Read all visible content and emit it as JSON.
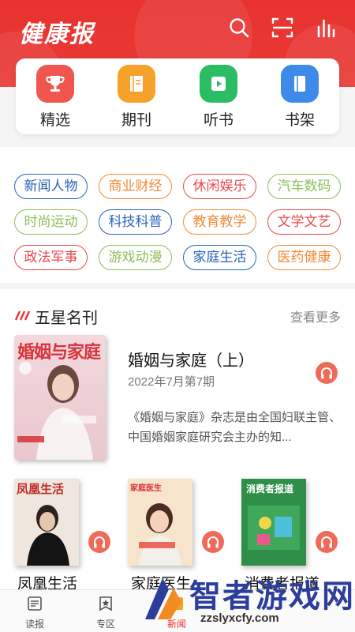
{
  "header": {
    "logo_text": "健康报",
    "icons": [
      "search-icon",
      "scan-icon",
      "chart-icon"
    ],
    "brand_color": "#e8322f"
  },
  "quick_nav": [
    {
      "label": "精选",
      "icon": "trophy-icon",
      "color": "#f0554f"
    },
    {
      "label": "期刊",
      "icon": "book-icon",
      "color": "#f6a22a"
    },
    {
      "label": "听书",
      "icon": "play-icon",
      "color": "#2bbd63"
    },
    {
      "label": "书架",
      "icon": "bookshelf-icon",
      "color": "#3d8ae8"
    }
  ],
  "categories": [
    {
      "label": "新闻人物",
      "color": "#2a63b8"
    },
    {
      "label": "商业财经",
      "color": "#f08a38"
    },
    {
      "label": "休闲娱乐",
      "color": "#e8494a"
    },
    {
      "label": "汽车数码",
      "color": "#8dbe5a"
    },
    {
      "label": "时尚运动",
      "color": "#8dbe5a"
    },
    {
      "label": "科技科普",
      "color": "#2a63b8"
    },
    {
      "label": "教育教学",
      "color": "#f08a38"
    },
    {
      "label": "文学文艺",
      "color": "#e8494a"
    },
    {
      "label": "政法军事",
      "color": "#e8494a"
    },
    {
      "label": "游戏动漫",
      "color": "#8dbe5a"
    },
    {
      "label": "家庭生活",
      "color": "#2a63b8"
    },
    {
      "label": "医药健康",
      "color": "#f08a38"
    }
  ],
  "section": {
    "title": "五星名刊",
    "more": "查看更多"
  },
  "featured": {
    "title": "婚姻与家庭（上）",
    "date": "2022年7月第7期",
    "description": "《婚姻与家庭》杂志是由全国妇联主管、中国婚姻家庭研究会主办的知...",
    "cover_title": "婚姻与家庭"
  },
  "magazines": [
    {
      "title": "凤凰生活",
      "cover_title": "凤凰生活"
    },
    {
      "title": "家庭医生",
      "cover_title": "家庭医生"
    },
    {
      "title": "消费者报道",
      "cover_title": "消费者报道"
    }
  ],
  "tabs": [
    {
      "label": "读报",
      "icon": "newspaper-icon"
    },
    {
      "label": "专区",
      "icon": "star-badge-icon"
    },
    {
      "label": "新闻",
      "icon": "news-icon"
    }
  ],
  "watermark": {
    "text": "智者游戏网",
    "url": "zzslyxcfy.com"
  }
}
